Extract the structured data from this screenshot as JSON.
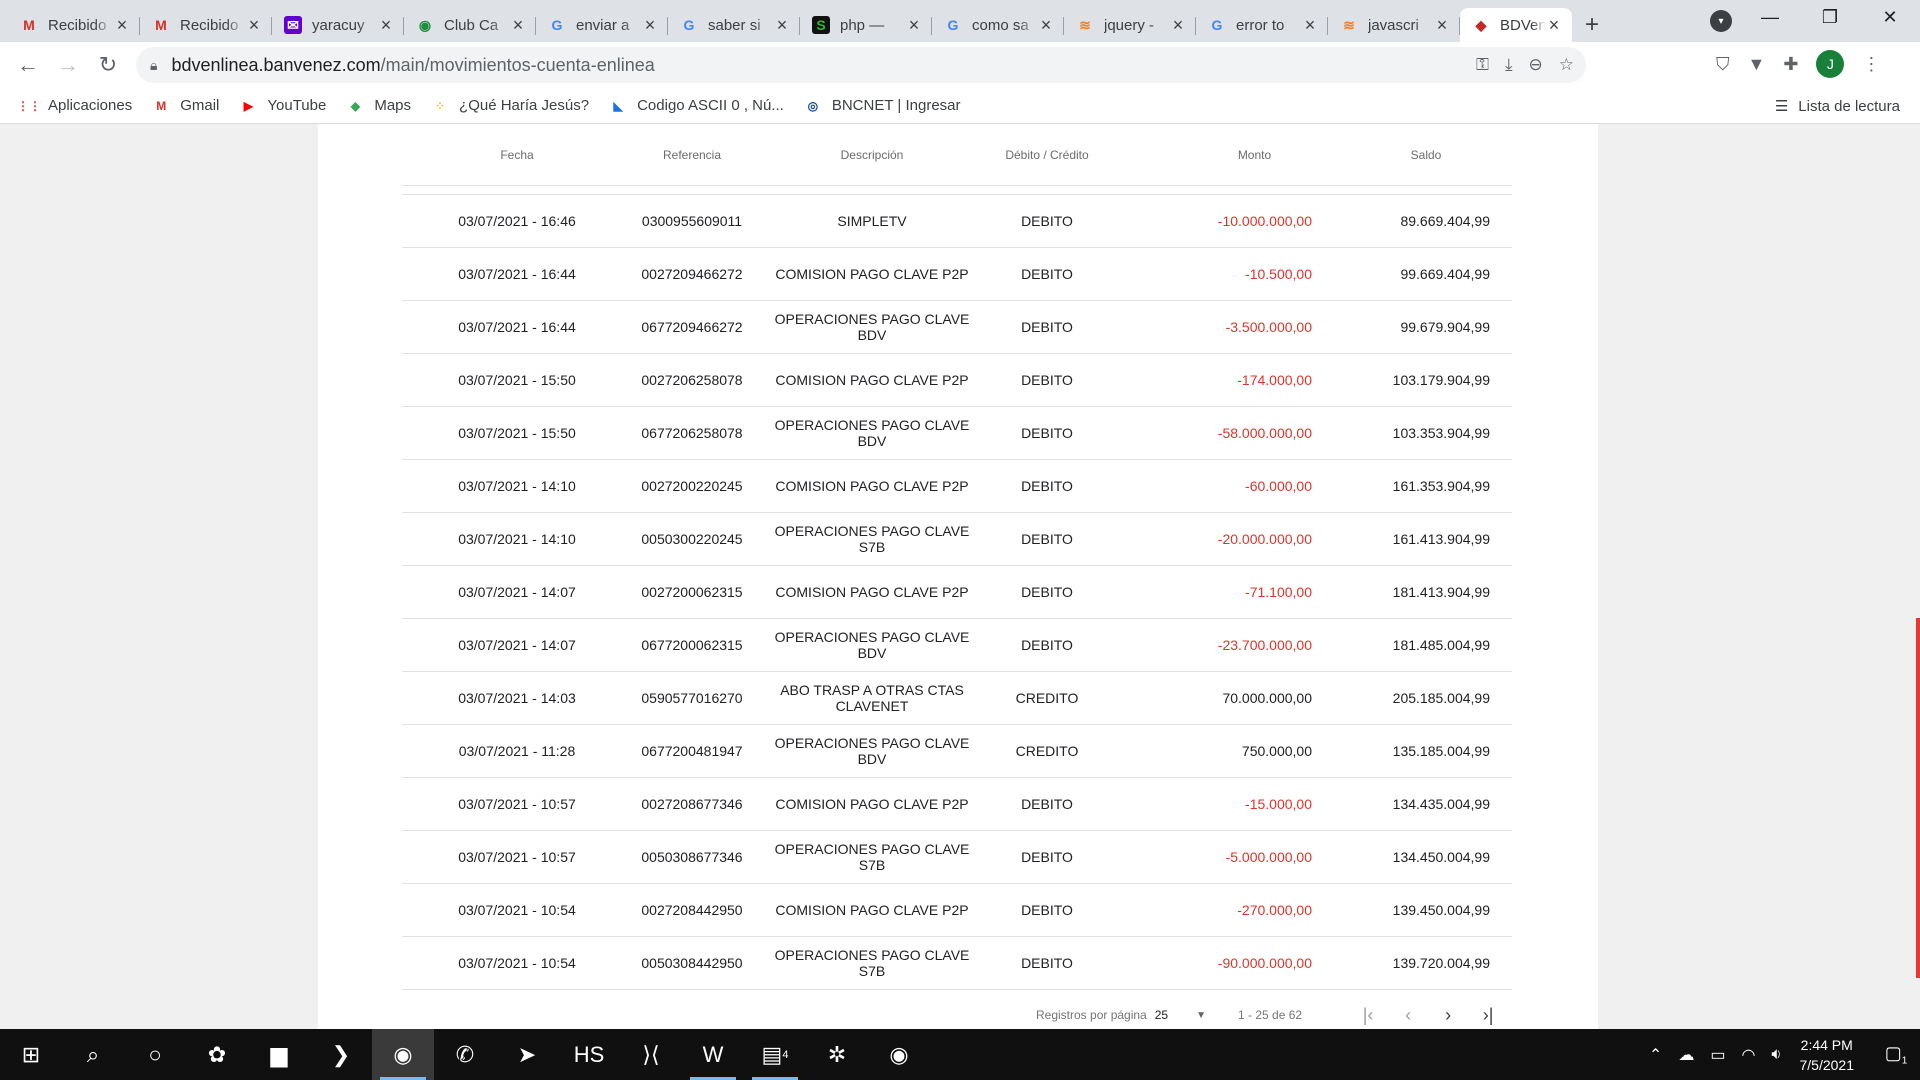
{
  "tabs": [
    {
      "title": "Recibido",
      "icon": "gmail-icon",
      "fav": "M",
      "fav_color": "#d93025",
      "fav_bg": "transparent"
    },
    {
      "title": "Recibido",
      "icon": "gmail-icon",
      "fav": "M",
      "fav_color": "#d93025",
      "fav_bg": "transparent"
    },
    {
      "title": "yaracuy",
      "icon": "yahoo-mail-icon",
      "fav": "✉",
      "fav_color": "#ffffff",
      "fav_bg": "#6001d2"
    },
    {
      "title": "Club Ca",
      "icon": "club-icon",
      "fav": "◉",
      "fav_color": "#1e8e3e",
      "fav_bg": "transparent"
    },
    {
      "title": "enviar a",
      "icon": "google-icon",
      "fav": "G",
      "fav_color": "#4285f4",
      "fav_bg": "transparent"
    },
    {
      "title": "saber si",
      "icon": "google-icon",
      "fav": "G",
      "fav_color": "#4285f4",
      "fav_bg": "transparent"
    },
    {
      "title": "php — ",
      "icon": "stackexchange-icon",
      "fav": "S",
      "fav_color": "#2eb82e",
      "fav_bg": "#111111"
    },
    {
      "title": "como sa",
      "icon": "google-icon",
      "fav": "G",
      "fav_color": "#4285f4",
      "fav_bg": "transparent"
    },
    {
      "title": "jquery -",
      "icon": "stackoverflow-icon",
      "fav": "≋",
      "fav_color": "#f48024",
      "fav_bg": "transparent"
    },
    {
      "title": "error to",
      "icon": "google-icon",
      "fav": "G",
      "fav_color": "#4285f4",
      "fav_bg": "transparent"
    },
    {
      "title": "javascri",
      "icon": "stackoverflow-icon",
      "fav": "≋",
      "fav_color": "#f48024",
      "fav_bg": "transparent"
    },
    {
      "title": "BDVenL",
      "icon": "bdv-icon",
      "fav": "◆",
      "fav_color": "#c62828",
      "fav_bg": "transparent",
      "active": true
    }
  ],
  "address": {
    "host": "bdvenlinea.banvenez.com",
    "path": "/main/movimientos-cuenta-enlinea"
  },
  "profile_initial": "J",
  "bookmarks": [
    {
      "label": "Aplicaciones",
      "icon": "apps-grid-icon",
      "glyph": "⋮⋮",
      "color": "#ea4335"
    },
    {
      "label": "Gmail",
      "icon": "gmail-icon",
      "glyph": "M",
      "color": "#d93025"
    },
    {
      "label": "YouTube",
      "icon": "youtube-icon",
      "glyph": "▶",
      "color": "#ff0000"
    },
    {
      "label": "Maps",
      "icon": "maps-icon",
      "glyph": "◆",
      "color": "#34a853"
    },
    {
      "label": "¿Qué Haría Jesús?",
      "icon": "dots-icon",
      "glyph": "⁘",
      "color": "#fbbc04"
    },
    {
      "label": "Codigo ASCII 0 , Nú...",
      "icon": "ascii-icon",
      "glyph": "◣",
      "color": "#1a73e8"
    },
    {
      "label": "BNCNET | Ingresar",
      "icon": "bnc-icon",
      "glyph": "◎",
      "color": "#0d47a1"
    }
  ],
  "reading_list": "Lista de lectura",
  "table": {
    "headers": [
      "Fecha",
      "Referencia",
      "Descripción",
      "Débito / Crédito",
      "Monto",
      "Saldo"
    ],
    "rows": [
      {
        "fecha": "03/07/2021 - 16:46",
        "ref": "0300955609011",
        "desc": "SIMPLETV",
        "tipo": "DEBITO",
        "monto": "-10.000.000,00",
        "saldo": "89.669.404,99",
        "neg": true
      },
      {
        "fecha": "03/07/2021 - 16:44",
        "ref": "0027209466272",
        "desc": "COMISION PAGO CLAVE P2P",
        "tipo": "DEBITO",
        "monto": "-10.500,00",
        "saldo": "99.669.404,99",
        "neg": true
      },
      {
        "fecha": "03/07/2021 - 16:44",
        "ref": "0677209466272",
        "desc": "OPERACIONES PAGO CLAVE BDV",
        "tipo": "DEBITO",
        "monto": "-3.500.000,00",
        "saldo": "99.679.904,99",
        "neg": true
      },
      {
        "fecha": "03/07/2021 - 15:50",
        "ref": "0027206258078",
        "desc": "COMISION PAGO CLAVE P2P",
        "tipo": "DEBITO",
        "monto": "-174.000,00",
        "saldo": "103.179.904,99",
        "neg": true
      },
      {
        "fecha": "03/07/2021 - 15:50",
        "ref": "0677206258078",
        "desc": "OPERACIONES PAGO CLAVE BDV",
        "tipo": "DEBITO",
        "monto": "-58.000.000,00",
        "saldo": "103.353.904,99",
        "neg": true
      },
      {
        "fecha": "03/07/2021 - 14:10",
        "ref": "0027200220245",
        "desc": "COMISION PAGO CLAVE P2P",
        "tipo": "DEBITO",
        "monto": "-60.000,00",
        "saldo": "161.353.904,99",
        "neg": true
      },
      {
        "fecha": "03/07/2021 - 14:10",
        "ref": "0050300220245",
        "desc": "OPERACIONES PAGO CLAVE S7B",
        "tipo": "DEBITO",
        "monto": "-20.000.000,00",
        "saldo": "161.413.904,99",
        "neg": true
      },
      {
        "fecha": "03/07/2021 - 14:07",
        "ref": "0027200062315",
        "desc": "COMISION PAGO CLAVE P2P",
        "tipo": "DEBITO",
        "monto": "-71.100,00",
        "saldo": "181.413.904,99",
        "neg": true
      },
      {
        "fecha": "03/07/2021 - 14:07",
        "ref": "0677200062315",
        "desc": "OPERACIONES PAGO CLAVE BDV",
        "tipo": "DEBITO",
        "monto": "-23.700.000,00",
        "saldo": "181.485.004,99",
        "neg": true
      },
      {
        "fecha": "03/07/2021 - 14:03",
        "ref": "0590577016270",
        "desc": "ABO TRASP A OTRAS CTAS CLAVENET",
        "tipo": "CREDITO",
        "monto": "70.000.000,00",
        "saldo": "205.185.004,99",
        "neg": false
      },
      {
        "fecha": "03/07/2021 - 11:28",
        "ref": "0677200481947",
        "desc": "OPERACIONES PAGO CLAVE BDV",
        "tipo": "CREDITO",
        "monto": "750.000,00",
        "saldo": "135.185.004,99",
        "neg": false
      },
      {
        "fecha": "03/07/2021 - 10:57",
        "ref": "0027208677346",
        "desc": "COMISION PAGO CLAVE P2P",
        "tipo": "DEBITO",
        "monto": "-15.000,00",
        "saldo": "134.435.004,99",
        "neg": true
      },
      {
        "fecha": "03/07/2021 - 10:57",
        "ref": "0050308677346",
        "desc": "OPERACIONES PAGO CLAVE S7B",
        "tipo": "DEBITO",
        "monto": "-5.000.000,00",
        "saldo": "134.450.004,99",
        "neg": true
      },
      {
        "fecha": "03/07/2021 - 10:54",
        "ref": "0027208442950",
        "desc": "COMISION PAGO CLAVE P2P",
        "tipo": "DEBITO",
        "monto": "-270.000,00",
        "saldo": "139.450.004,99",
        "neg": true
      },
      {
        "fecha": "03/07/2021 - 10:54",
        "ref": "0050308442950",
        "desc": "OPERACIONES PAGO CLAVE S7B",
        "tipo": "DEBITO",
        "monto": "-90.000.000,00",
        "saldo": "139.720.004,99",
        "neg": true
      }
    ]
  },
  "pagination": {
    "label": "Registros por página",
    "per_page": "25",
    "range": "1 - 25 de 62"
  },
  "colors": {
    "negative": "#e0342b",
    "scroll_accent": "#e53935"
  },
  "taskbar": {
    "apps": [
      {
        "name": "start-icon",
        "glyph": "⊞"
      },
      {
        "name": "search-icon",
        "glyph": "⌕"
      },
      {
        "name": "task-view-icon",
        "glyph": "○"
      },
      {
        "name": "paint-icon",
        "glyph": "✿"
      },
      {
        "name": "file-explorer-icon",
        "glyph": "▆"
      },
      {
        "name": "powershell-icon",
        "glyph": "❯"
      },
      {
        "name": "chrome-icon",
        "glyph": "◉",
        "open": true,
        "active": true
      },
      {
        "name": "whatsapp-icon",
        "glyph": "✆"
      },
      {
        "name": "telegram-icon",
        "glyph": "➤"
      },
      {
        "name": "heidisql-icon",
        "glyph": "HS"
      },
      {
        "name": "vscode-icon",
        "glyph": "⟩⟨"
      },
      {
        "name": "word-icon",
        "glyph": "W",
        "open": true
      },
      {
        "name": "notepad-icon",
        "glyph": "▤",
        "badge": "4",
        "open": true
      },
      {
        "name": "slack-icon",
        "glyph": "✲"
      },
      {
        "name": "chrome-alt-icon",
        "glyph": "◉"
      }
    ],
    "time": "2:44 PM",
    "date": "7/5/2021",
    "notification_count": "1"
  }
}
